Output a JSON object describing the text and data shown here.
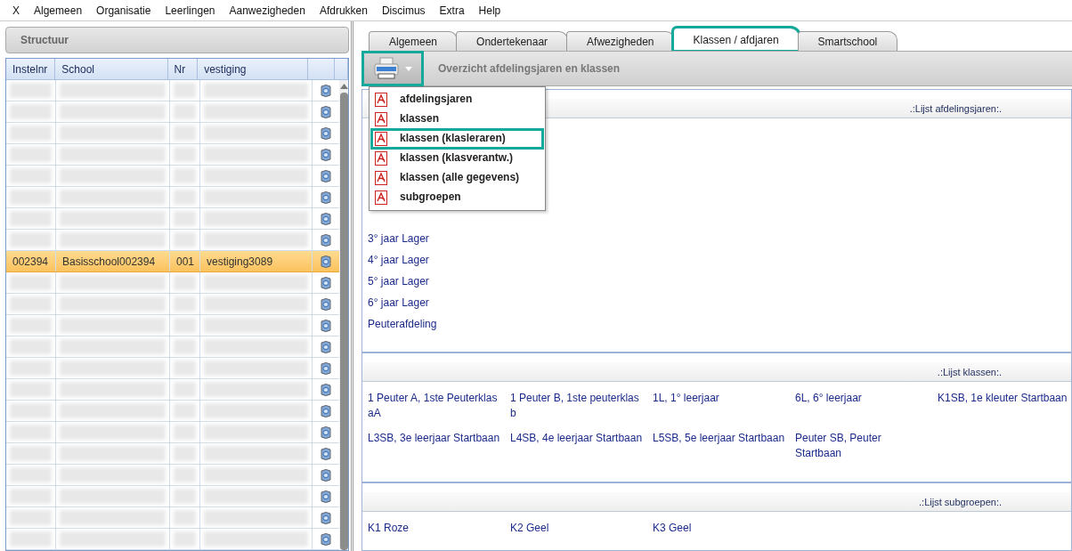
{
  "menu": [
    "X",
    "Algemeen",
    "Organisatie",
    "Leerlingen",
    "Aanwezigheden",
    "Afdrukken",
    "Discimus",
    "Extra",
    "Help"
  ],
  "left_panel": {
    "title": "Structuur",
    "columns": [
      "Instelnr",
      "School",
      "Nr",
      "vestiging"
    ],
    "rows": [
      {
        "kind": "redacted",
        "selected": false
      },
      {
        "kind": "redacted",
        "selected": false
      },
      {
        "kind": "redacted",
        "selected": false
      },
      {
        "kind": "redacted",
        "selected": false
      },
      {
        "kind": "redacted",
        "selected": false
      },
      {
        "kind": "redacted",
        "selected": false
      },
      {
        "kind": "redacted",
        "selected": false
      },
      {
        "kind": "redacted",
        "selected": false
      },
      {
        "kind": "data",
        "selected": true,
        "cells": [
          "002394",
          "Basisschool002394",
          "001",
          "vestiging3089"
        ]
      },
      {
        "kind": "redacted",
        "selected": false
      },
      {
        "kind": "redacted",
        "selected": false
      },
      {
        "kind": "redacted",
        "selected": false
      },
      {
        "kind": "redacted",
        "selected": false
      },
      {
        "kind": "redacted",
        "selected": false
      },
      {
        "kind": "redacted",
        "selected": false
      },
      {
        "kind": "redacted",
        "selected": false
      },
      {
        "kind": "redacted",
        "selected": false
      },
      {
        "kind": "redacted",
        "selected": false
      },
      {
        "kind": "redacted",
        "selected": false
      },
      {
        "kind": "redacted",
        "selected": false
      },
      {
        "kind": "redacted",
        "selected": false
      },
      {
        "kind": "redacted",
        "selected": false
      }
    ]
  },
  "tabs": [
    {
      "label": "Algemeen",
      "selected": false,
      "highlighted": false
    },
    {
      "label": "Ondertekenaar",
      "selected": false,
      "highlighted": false
    },
    {
      "label": "Afwezigheden",
      "selected": false,
      "highlighted": false
    },
    {
      "label": "Klassen / afdjaren",
      "selected": true,
      "highlighted": true
    },
    {
      "label": "Smartschool",
      "selected": false,
      "highlighted": false
    }
  ],
  "toolbar": {
    "print_highlighted": true,
    "title": "Overzicht afdelingsjaren en klassen"
  },
  "print_menu": [
    {
      "label": "afdelingsjaren",
      "highlighted": false
    },
    {
      "label": "klassen",
      "highlighted": false
    },
    {
      "label": "klassen (klasleraren)",
      "highlighted": true
    },
    {
      "label": "klassen (klasverantw.)",
      "highlighted": false
    },
    {
      "label": "klassen (alle gegevens)",
      "highlighted": false
    },
    {
      "label": "subgroepen",
      "highlighted": false
    }
  ],
  "sections": [
    {
      "title": ".:Lijst afdelingsjaren:.",
      "kind": "list",
      "items": [
        "3° jaar Lager",
        "4° jaar Lager",
        "5° jaar Lager",
        "6° jaar Lager",
        "Peuterafdeling"
      ]
    },
    {
      "title": ".:Lijst klassen:.",
      "kind": "grid",
      "items": [
        "1 Peuter A, 1ste Peuterklas aA",
        "1 Peuter B, 1ste peuterklas b",
        "1L, 1° leerjaar",
        "6L, 6° leerjaar",
        "K1SB, 1e kleuter Startbaan",
        "L3SB, 3e leerjaar Startbaan",
        "L4SB, 4e leerjaar Startbaan",
        "L5SB, 5e leerjaar Startbaan",
        "Peuter SB, Peuter Startbaan"
      ]
    },
    {
      "title": ".:Lijst subgroepen:.",
      "kind": "grid",
      "items": [
        "K1 Roze",
        "K2 Geel",
        "K3 Geel"
      ]
    }
  ]
}
